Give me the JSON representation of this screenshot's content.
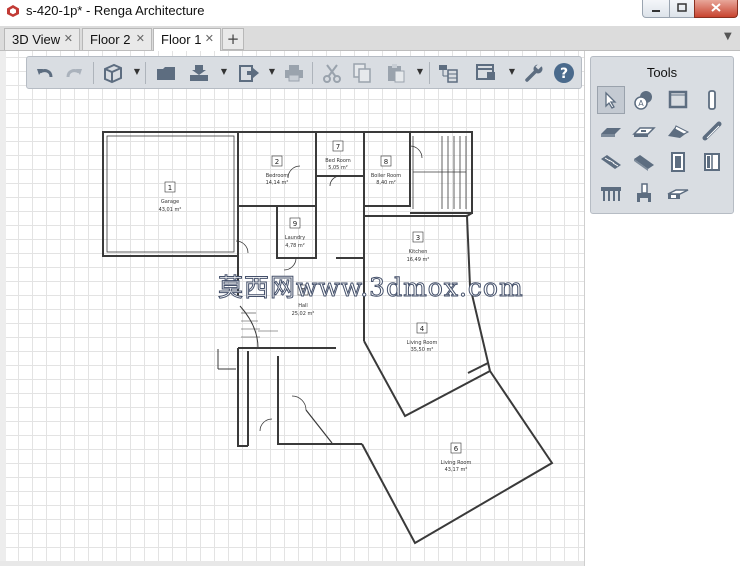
{
  "window": {
    "title": "s-420-1p* - Renga Architecture"
  },
  "tabs": [
    {
      "label": "3D View",
      "active": false
    },
    {
      "label": "Floor 2",
      "active": false
    },
    {
      "label": "Floor 1",
      "active": true
    }
  ],
  "tab_add_label": "+",
  "tab_close_glyph": "✕",
  "tools_panel": {
    "title": "Tools"
  },
  "toolbar_icons": [
    "undo-icon",
    "redo-icon",
    "view-3d-icon",
    "open-icon",
    "import-icon",
    "export-icon",
    "print-icon",
    "cut-icon",
    "copy-icon",
    "paste-icon",
    "levels-icon",
    "layers-icon",
    "settings-wrench-icon",
    "help-icon"
  ],
  "tool_icons": [
    "select-icon",
    "materials-icon",
    "wall-icon",
    "column-icon",
    "floor-icon",
    "slab-icon",
    "roof-icon",
    "beam-icon",
    "stairs-icon",
    "ramp-icon",
    "door-icon",
    "window-icon",
    "railing-icon",
    "furniture-icon",
    "opening-icon"
  ],
  "rooms": [
    {
      "num": "1",
      "name": "Garage",
      "area": "43,01 m²"
    },
    {
      "num": "2",
      "name": "Bedroom",
      "area": "14,14 m²"
    },
    {
      "num": "7",
      "name": "Bed Room",
      "area": "5,05 m²"
    },
    {
      "num": "8",
      "name": "Boiler Room",
      "area": "8,40 m²"
    },
    {
      "num": "9",
      "name": "Laundry",
      "area": "4,78 m²"
    },
    {
      "num": "3",
      "name": "Kitchen",
      "area": "16,49 m²"
    },
    {
      "num": "5",
      "name": "Hall",
      "area": "25,02 m²"
    },
    {
      "num": "4",
      "name": "Living Room",
      "area": "35,50 m²"
    },
    {
      "num": "6",
      "name": "Living Room",
      "area": "43,17 m²"
    }
  ],
  "watermark": "莫西网www.3dmox.com",
  "colors": {
    "toolbar_bg": "#d9dde2",
    "icon_blue": "#5d6d80",
    "close_red": "#c8432f",
    "help_blue": "#4a6a8c"
  }
}
